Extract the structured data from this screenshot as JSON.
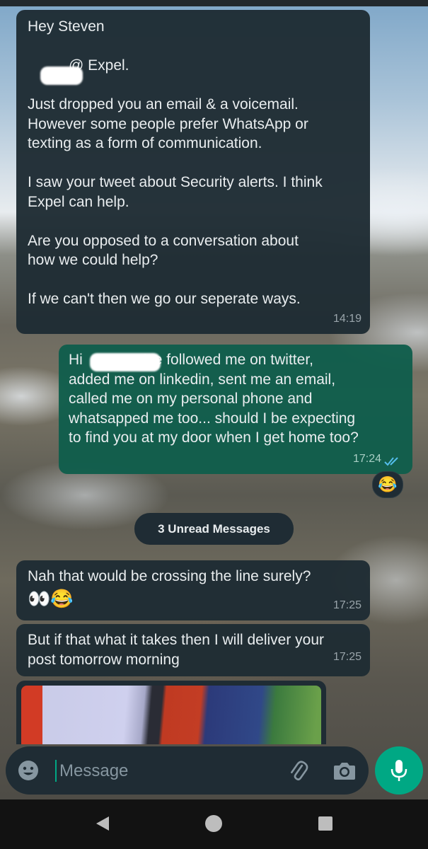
{
  "messages": [
    {
      "direction": "incoming",
      "lines": [
        "Hey Steven",
        "",
        "@ Expel.",
        "",
        "Just dropped you an email & a voicemail.",
        "However some people prefer WhatsApp or",
        "texting as a form of communication.",
        "",
        "I saw your tweet about Security alerts. I think",
        "Expel can help.",
        "",
        "Are you opposed to a conversation about",
        "how we could help?",
        "",
        "If we can't then we go our seperate ways."
      ],
      "time": "14:19"
    },
    {
      "direction": "outgoing",
      "lines": [
        "Hi         you've followed me on twitter,",
        "added me on linkedin, sent me an email,",
        "called me on my personal phone and",
        "whatsapped me too... should I be expecting",
        "to find you at my door when I get home too?"
      ],
      "time": "17:24",
      "status": "read",
      "reaction": "😂"
    },
    {
      "direction": "incoming",
      "lines": [
        "Nah that would be crossing the line surely?",
        "👀😂"
      ],
      "time": "17:25"
    },
    {
      "direction": "incoming",
      "lines": [
        "But if that what it takes then I will deliver your",
        "post tomorrow morning"
      ],
      "time": "17:25"
    }
  ],
  "unread_banner": "3 Unread Messages",
  "composer": {
    "placeholder": "Message"
  },
  "icons": {
    "emoji": "emoji-icon",
    "attach": "paperclip-icon",
    "camera": "camera-icon",
    "mic": "mic-icon",
    "read_status": "double-check-icon",
    "nav_back": "back-triangle-icon",
    "nav_home": "home-circle-icon",
    "nav_recents": "recents-square-icon"
  },
  "colors": {
    "incoming_bubble": "#1f2c34",
    "outgoing_bubble": "#005c4b",
    "accent": "#00a884",
    "read_ticks": "#53bdeb"
  }
}
